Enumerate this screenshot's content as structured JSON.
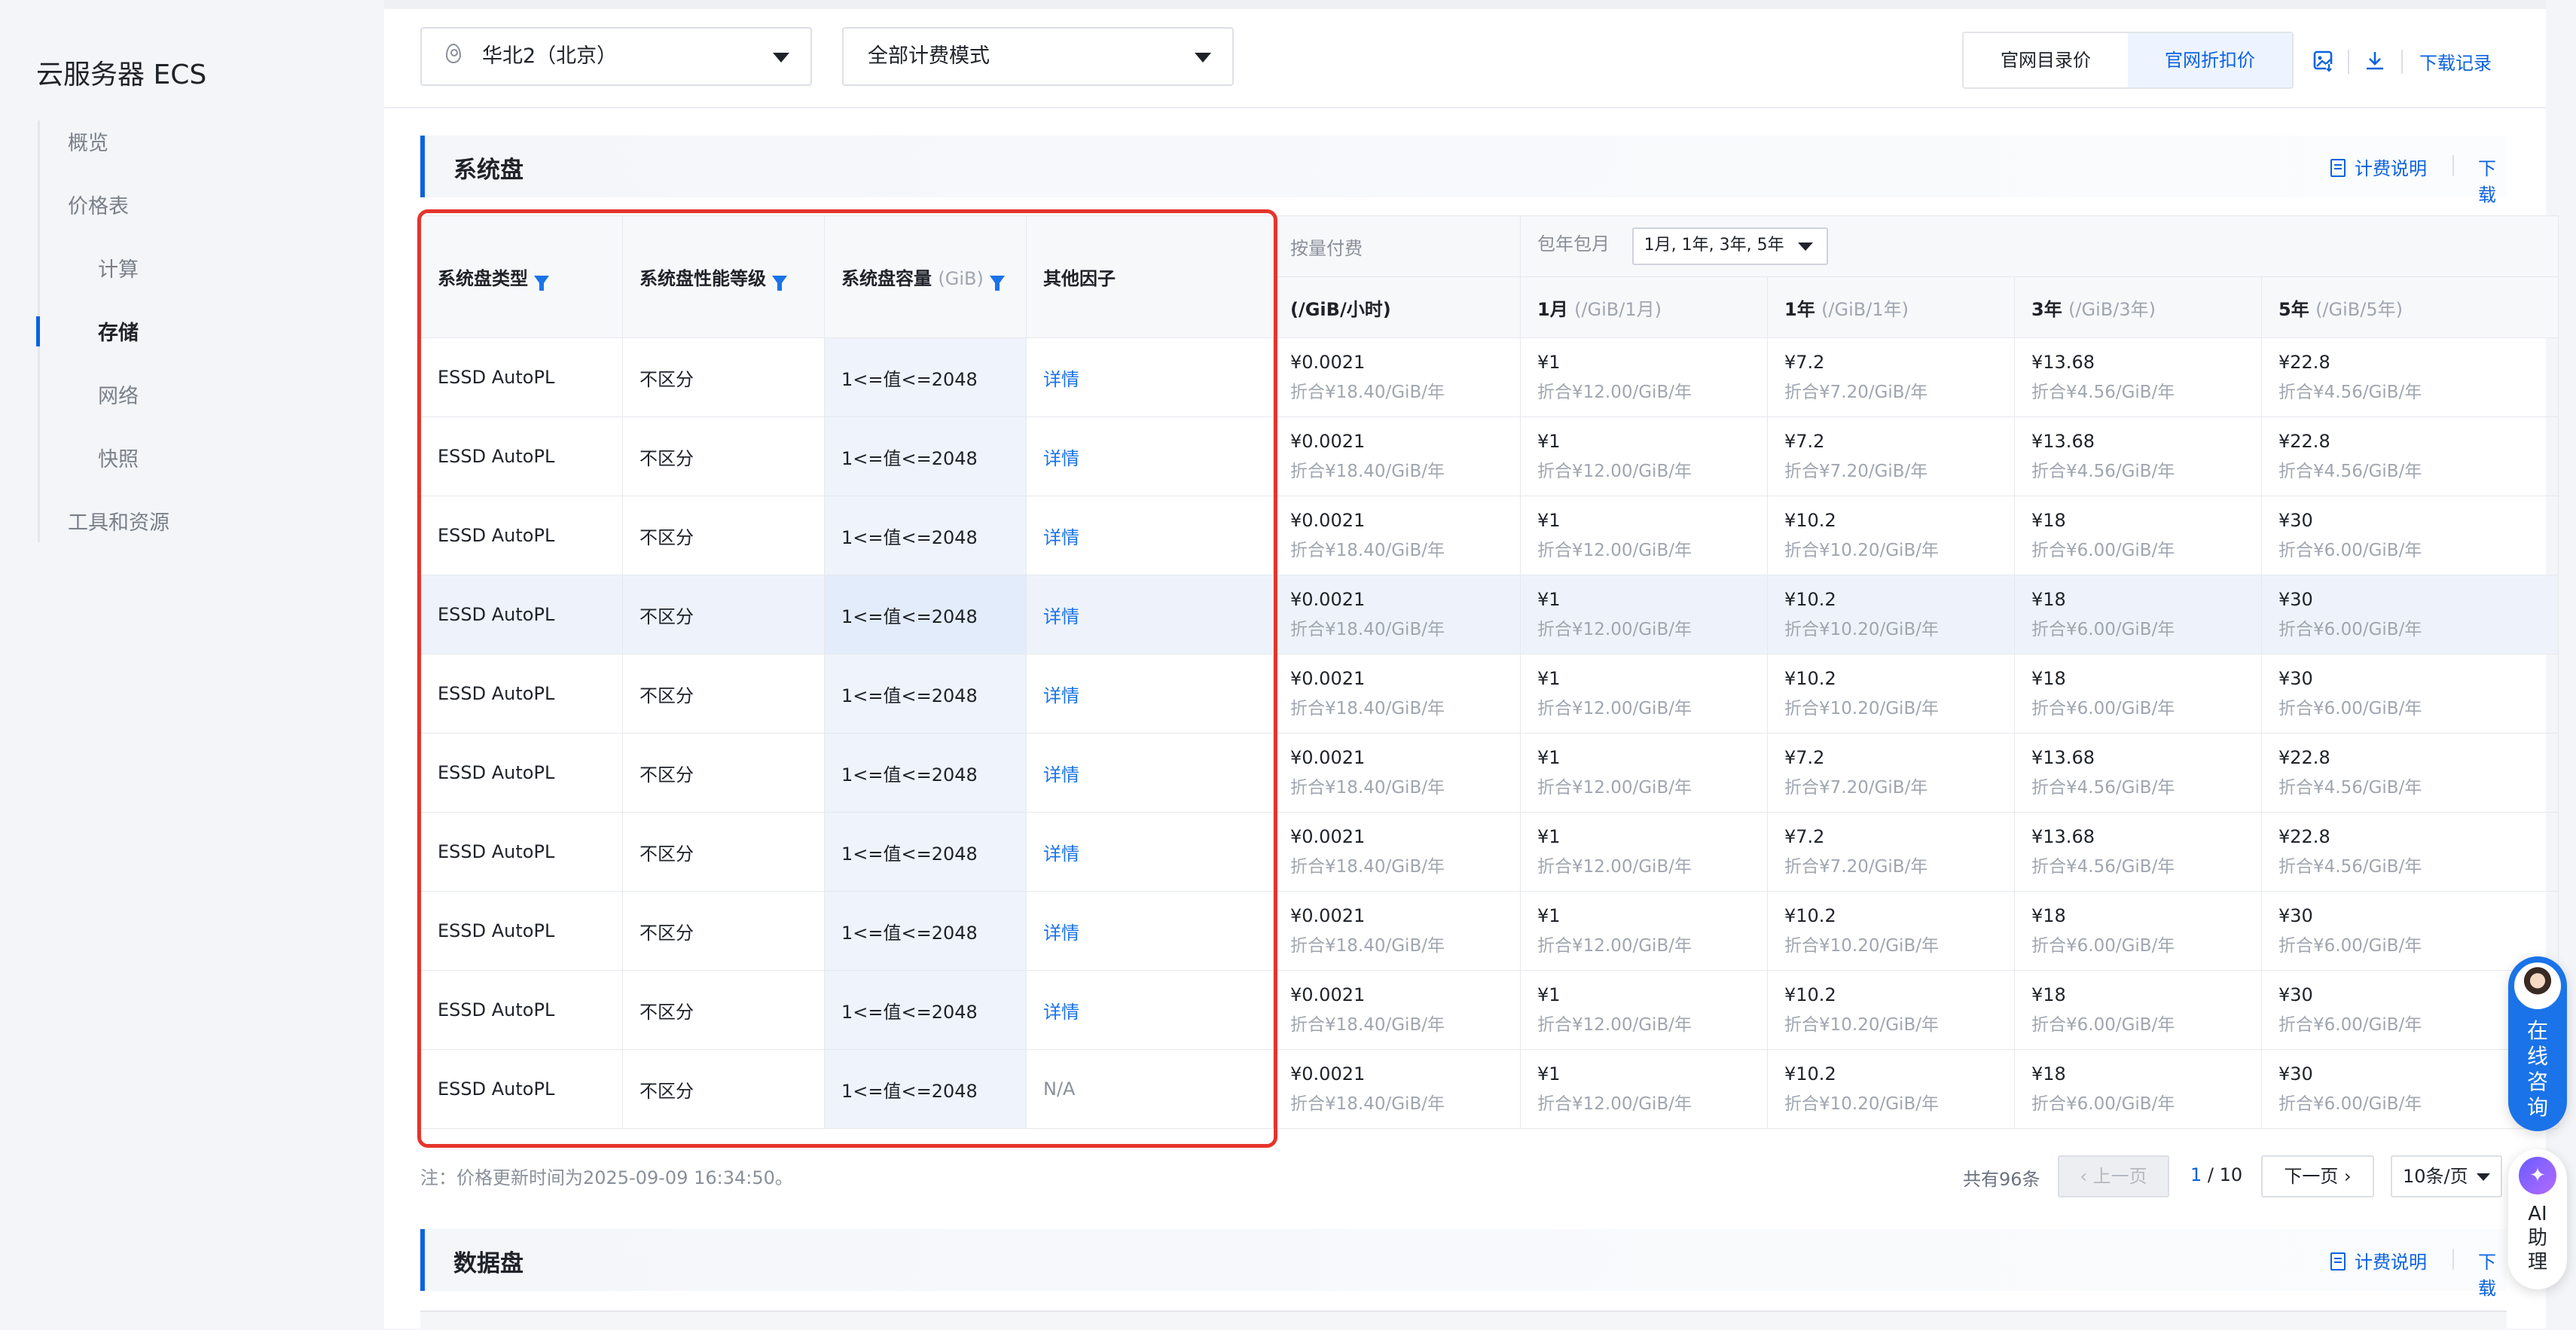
{
  "sidebar": {
    "app_title": "云服务器 ECS",
    "items": [
      {
        "label": "概览",
        "level": 1,
        "active": false
      },
      {
        "label": "价格表",
        "level": 1,
        "active": false
      },
      {
        "label": "计算",
        "level": 2,
        "active": false
      },
      {
        "label": "存储",
        "level": 2,
        "active": true
      },
      {
        "label": "网络",
        "level": 2,
        "active": false
      },
      {
        "label": "快照",
        "level": 2,
        "active": false
      },
      {
        "label": "工具和资源",
        "level": 1,
        "active": false
      }
    ]
  },
  "filters": {
    "region": "华北2（北京）",
    "billing_mode": "全部计费模式",
    "price_toggle": [
      "官网目录价",
      "官网折扣价"
    ],
    "price_toggle_selected": "官网折扣价",
    "download_records": "下载记录"
  },
  "section": {
    "title": "系统盘",
    "billing_doc": "计费说明",
    "download": "下载"
  },
  "table": {
    "headers": {
      "disk_type": "系统盘类型",
      "perf_level": "系统盘性能等级",
      "capacity": "系统盘容量",
      "capacity_unit": "(GiB)",
      "other_factors": "其他因子",
      "pay_as_you_go": "按量付费",
      "subscription": "包年包月",
      "subscription_cycles": "1月, 1年, 3年, 5年",
      "hourly": "(/GiB/小时)",
      "m1": "1月",
      "m1_unit": "(/GiB/1月)",
      "y1": "1年",
      "y1_unit": "(/GiB/1年)",
      "y3": "3年",
      "y3_unit": "(/GiB/3年)",
      "y5": "5年",
      "y5_unit": "(/GiB/5年)"
    },
    "rows": [
      {
        "type": "ESSD AutoPL",
        "level": "不区分",
        "capacity": "1<=值<=2048",
        "other": "详情",
        "hourly": "¥0.0021",
        "hourly_sub": "折合¥18.40/GiB/年",
        "m1": "¥1",
        "m1_sub": "折合¥12.00/GiB/年",
        "y1": "¥7.2",
        "y1_sub": "折合¥7.20/GiB/年",
        "y3": "¥13.68",
        "y3_sub": "折合¥4.56/GiB/年",
        "y5": "¥22.8",
        "y5_sub": "折合¥4.56/GiB/年"
      },
      {
        "type": "ESSD AutoPL",
        "level": "不区分",
        "capacity": "1<=值<=2048",
        "other": "详情",
        "hourly": "¥0.0021",
        "hourly_sub": "折合¥18.40/GiB/年",
        "m1": "¥1",
        "m1_sub": "折合¥12.00/GiB/年",
        "y1": "¥7.2",
        "y1_sub": "折合¥7.20/GiB/年",
        "y3": "¥13.68",
        "y3_sub": "折合¥4.56/GiB/年",
        "y5": "¥22.8",
        "y5_sub": "折合¥4.56/GiB/年"
      },
      {
        "type": "ESSD AutoPL",
        "level": "不区分",
        "capacity": "1<=值<=2048",
        "other": "详情",
        "hourly": "¥0.0021",
        "hourly_sub": "折合¥18.40/GiB/年",
        "m1": "¥1",
        "m1_sub": "折合¥12.00/GiB/年",
        "y1": "¥10.2",
        "y1_sub": "折合¥10.20/GiB/年",
        "y3": "¥18",
        "y3_sub": "折合¥6.00/GiB/年",
        "y5": "¥30",
        "y5_sub": "折合¥6.00/GiB/年"
      },
      {
        "type": "ESSD AutoPL",
        "level": "不区分",
        "capacity": "1<=值<=2048",
        "other": "详情",
        "hourly": "¥0.0021",
        "hourly_sub": "折合¥18.40/GiB/年",
        "m1": "¥1",
        "m1_sub": "折合¥12.00/GiB/年",
        "y1": "¥10.2",
        "y1_sub": "折合¥10.20/GiB/年",
        "y3": "¥18",
        "y3_sub": "折合¥6.00/GiB/年",
        "y5": "¥30",
        "y5_sub": "折合¥6.00/GiB/年"
      },
      {
        "type": "ESSD AutoPL",
        "level": "不区分",
        "capacity": "1<=值<=2048",
        "other": "详情",
        "hourly": "¥0.0021",
        "hourly_sub": "折合¥18.40/GiB/年",
        "m1": "¥1",
        "m1_sub": "折合¥12.00/GiB/年",
        "y1": "¥10.2",
        "y1_sub": "折合¥10.20/GiB/年",
        "y3": "¥18",
        "y3_sub": "折合¥6.00/GiB/年",
        "y5": "¥30",
        "y5_sub": "折合¥6.00/GiB/年"
      },
      {
        "type": "ESSD AutoPL",
        "level": "不区分",
        "capacity": "1<=值<=2048",
        "other": "详情",
        "hourly": "¥0.0021",
        "hourly_sub": "折合¥18.40/GiB/年",
        "m1": "¥1",
        "m1_sub": "折合¥12.00/GiB/年",
        "y1": "¥7.2",
        "y1_sub": "折合¥7.20/GiB/年",
        "y3": "¥13.68",
        "y3_sub": "折合¥4.56/GiB/年",
        "y5": "¥22.8",
        "y5_sub": "折合¥4.56/GiB/年"
      },
      {
        "type": "ESSD AutoPL",
        "level": "不区分",
        "capacity": "1<=值<=2048",
        "other": "详情",
        "hourly": "¥0.0021",
        "hourly_sub": "折合¥18.40/GiB/年",
        "m1": "¥1",
        "m1_sub": "折合¥12.00/GiB/年",
        "y1": "¥7.2",
        "y1_sub": "折合¥7.20/GiB/年",
        "y3": "¥13.68",
        "y3_sub": "折合¥4.56/GiB/年",
        "y5": "¥22.8",
        "y5_sub": "折合¥4.56/GiB/年"
      },
      {
        "type": "ESSD AutoPL",
        "level": "不区分",
        "capacity": "1<=值<=2048",
        "other": "详情",
        "hourly": "¥0.0021",
        "hourly_sub": "折合¥18.40/GiB/年",
        "m1": "¥1",
        "m1_sub": "折合¥12.00/GiB/年",
        "y1": "¥10.2",
        "y1_sub": "折合¥10.20/GiB/年",
        "y3": "¥18",
        "y3_sub": "折合¥6.00/GiB/年",
        "y5": "¥30",
        "y5_sub": "折合¥6.00/GiB/年"
      },
      {
        "type": "ESSD AutoPL",
        "level": "不区分",
        "capacity": "1<=值<=2048",
        "other": "详情",
        "hourly": "¥0.0021",
        "hourly_sub": "折合¥18.40/GiB/年",
        "m1": "¥1",
        "m1_sub": "折合¥12.00/GiB/年",
        "y1": "¥10.2",
        "y1_sub": "折合¥10.20/GiB/年",
        "y3": "¥18",
        "y3_sub": "折合¥6.00/GiB/年",
        "y5": "¥30",
        "y5_sub": "折合¥6.00/GiB/年"
      },
      {
        "type": "ESSD AutoPL",
        "level": "不区分",
        "capacity": "1<=值<=2048",
        "other": "N/A",
        "hourly": "¥0.0021",
        "hourly_sub": "折合¥18.40/GiB/年",
        "m1": "¥1",
        "m1_sub": "折合¥12.00/GiB/年",
        "y1": "¥10.2",
        "y1_sub": "折合¥10.20/GiB/年",
        "y3": "¥18",
        "y3_sub": "折合¥6.00/GiB/年",
        "y5": "¥30",
        "y5_sub": "折合¥6.00/GiB/年"
      }
    ],
    "highlighted_row": 3
  },
  "footer": {
    "note": "注：价格更新时间为2025-09-09 16:34:50。",
    "total": "共有96条",
    "prev": "上一页",
    "page_current": "1",
    "page_sep": " / ",
    "page_total": "10",
    "next": "下一页",
    "page_size": "10条/页"
  },
  "section2": {
    "title": "数据盘",
    "billing_doc": "计费说明",
    "download": "下载"
  },
  "float": {
    "consult": "在线咨询",
    "ai": "AI助理"
  },
  "colors": {
    "accent": "#0b62e0",
    "highlight_box": "#e5342c"
  }
}
